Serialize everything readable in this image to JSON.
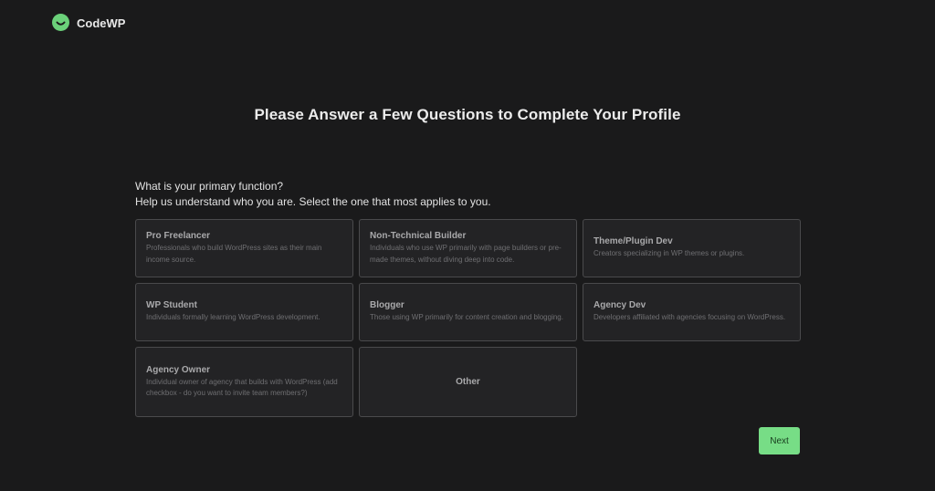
{
  "brand": {
    "name": "CodeWP",
    "logo_icon": "smile-icon",
    "accent_color": "#6bd17a"
  },
  "page": {
    "title": "Please Answer a Few Questions to Complete Your Profile"
  },
  "question": {
    "label": "What is your primary function?",
    "helper": "Help us understand who you are. Select the one that most applies to you."
  },
  "options": [
    {
      "title": "Pro Freelancer",
      "description": "Professionals who build WordPress sites as their main income source."
    },
    {
      "title": "Non-Technical Builder",
      "description": "Individuals who use WP primarily with page builders or pre-made themes, without diving deep into code."
    },
    {
      "title": "Theme/Plugin Dev",
      "description": "Creators specializing in WP themes or plugins."
    },
    {
      "title": "WP Student",
      "description": "Individuals formally learning WordPress development."
    },
    {
      "title": "Blogger",
      "description": "Those using WP primarily for content creation and blogging."
    },
    {
      "title": "Agency Dev",
      "description": "Developers affiliated with agencies focusing on WordPress."
    },
    {
      "title": "Agency Owner",
      "description": "Individual owner of agency that builds with WordPress (add checkbox - do you want to invite team members?)"
    },
    {
      "title": "Other"
    }
  ],
  "actions": {
    "next_label": "Next",
    "next_color": "#77dd86"
  }
}
